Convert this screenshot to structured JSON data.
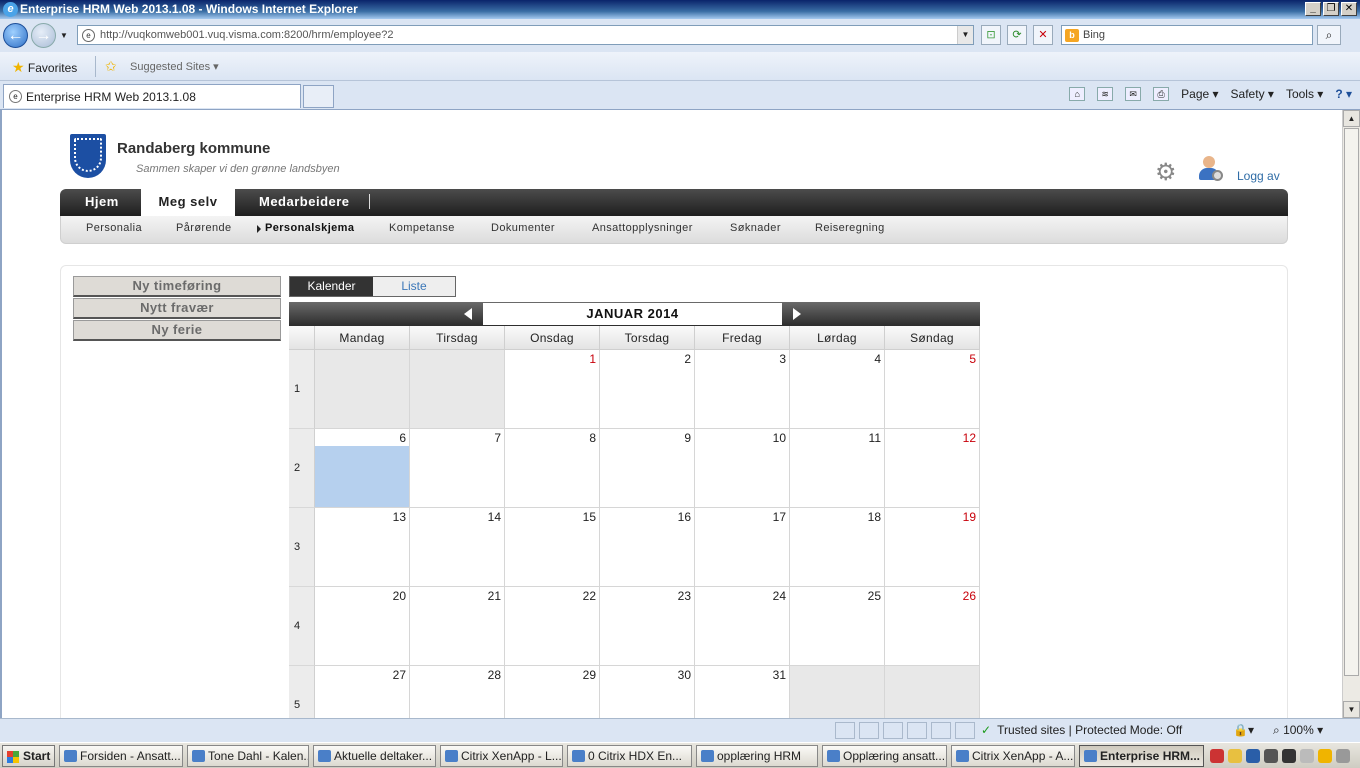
{
  "window": {
    "title": "Enterprise HRM Web 2013.1.08 - Windows Internet Explorer"
  },
  "browser": {
    "url": "http://vuqkomweb001.vuq.visma.com:8200/hrm/employee?2",
    "search_placeholder": "Bing",
    "favorites_label": "Favorites",
    "suggested_sites_label": "Suggested Sites",
    "tab_title": "Enterprise HRM Web 2013.1.08",
    "cmd": {
      "page": "Page",
      "safety": "Safety",
      "tools": "Tools"
    }
  },
  "site": {
    "org_name": "Randaberg kommune",
    "tagline": "Sammen skaper vi den grønne landsbyen",
    "logout": "Logg av"
  },
  "mainnav": [
    {
      "label": "Hjem",
      "active": false
    },
    {
      "label": "Meg selv",
      "active": true
    },
    {
      "label": "Medarbeidere",
      "active": false
    }
  ],
  "subnav": [
    {
      "label": "Personalia"
    },
    {
      "label": "Pårørende"
    },
    {
      "label": "Personalskjema",
      "active": true
    },
    {
      "label": "Kompetanse"
    },
    {
      "label": "Dokumenter"
    },
    {
      "label": "Ansattopplysninger"
    },
    {
      "label": "Søknader"
    },
    {
      "label": "Reiseregning"
    }
  ],
  "sidebar": [
    {
      "label": "Ny timeføring"
    },
    {
      "label": "Nytt fravær"
    },
    {
      "label": "Ny ferie"
    }
  ],
  "view_toggle": {
    "calendar": "Kalender",
    "list": "Liste"
  },
  "calendar": {
    "month_label": "JANUAR 2014",
    "weekdays": [
      "Mandag",
      "Tirsdag",
      "Onsdag",
      "Torsdag",
      "Fredag",
      "Lørdag",
      "Søndag"
    ],
    "weeks": [
      {
        "week": "1",
        "days": [
          "",
          "",
          "1",
          "2",
          "3",
          "4",
          "5"
        ]
      },
      {
        "week": "2",
        "days": [
          "6",
          "7",
          "8",
          "9",
          "10",
          "11",
          "12"
        ]
      },
      {
        "week": "3",
        "days": [
          "13",
          "14",
          "15",
          "16",
          "17",
          "18",
          "19"
        ]
      },
      {
        "week": "4",
        "days": [
          "20",
          "21",
          "22",
          "23",
          "24",
          "25",
          "26"
        ]
      },
      {
        "week": "5",
        "days": [
          "27",
          "28",
          "29",
          "30",
          "31",
          "",
          ""
        ]
      }
    ],
    "holidays": [
      "1"
    ],
    "selected_day": "6",
    "colors": {
      "holiday": "#c8000a",
      "selected": "#b6d0ee",
      "outside": "#e8e8e8"
    }
  },
  "statusbar": {
    "zone": "Trusted sites | Protected Mode: Off",
    "zoom": "100%"
  },
  "taskbar": {
    "start": "Start",
    "tasks": [
      {
        "label": "Forsiden - Ansatt..."
      },
      {
        "label": "Tone Dahl - Kalen..."
      },
      {
        "label": "Aktuelle deltaker..."
      },
      {
        "label": "Citrix XenApp - L..."
      },
      {
        "label": "0 Citrix HDX En..."
      },
      {
        "label": "opplæring HRM"
      },
      {
        "label": "Opplæring ansatt..."
      },
      {
        "label": "Citrix XenApp - A..."
      },
      {
        "label": "Enterprise HRM...",
        "active": true
      }
    ]
  }
}
